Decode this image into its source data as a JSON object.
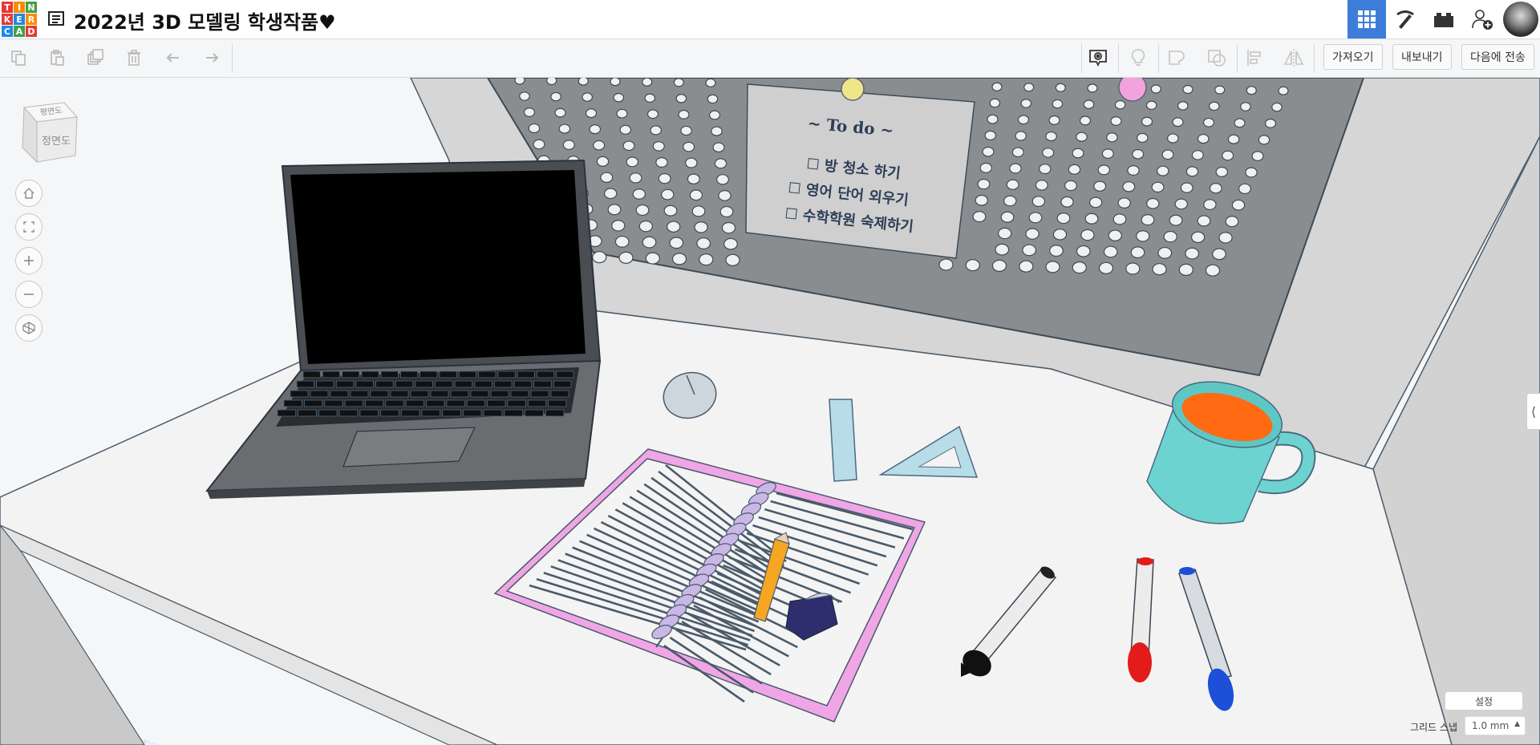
{
  "app": {
    "logo_letters": [
      "T",
      "I",
      "N",
      "K",
      "E",
      "R",
      "C",
      "A",
      "D"
    ],
    "logo_colors": [
      "#e53935",
      "#fb8c00",
      "#43a047",
      "#e53935",
      "#1e88e5",
      "#fb8c00",
      "#1e88e5",
      "#43a047",
      "#e53935"
    ],
    "title": "2022년 3D 모델링 학생작품♥",
    "accent": "#3c7dd9"
  },
  "top_icons": [
    "grid-view-icon",
    "pickaxe-icon",
    "bricks-icon",
    "add-user-icon",
    "avatar"
  ],
  "toolbar": {
    "left_icons": [
      "copy-icon",
      "paste-icon",
      "duplicate-icon",
      "delete-icon",
      "undo-icon",
      "redo-icon"
    ],
    "right_icons": [
      "notes-icon",
      "light-icon",
      "shape-icon",
      "group-icon",
      "align-icon",
      "mirror-icon"
    ],
    "import_label": "가져오기",
    "export_label": "내보내기",
    "send_label": "다음에 전송"
  },
  "viewcube": {
    "top_label": "평면도",
    "front_label": "정면도"
  },
  "nav_buttons": [
    "home-view-icon",
    "fit-all-icon",
    "zoom-in-icon",
    "zoom-out-icon",
    "perspective-icon"
  ],
  "scene": {
    "note_title": "~ To do ~",
    "note_items": [
      "방 청소 하기",
      "영어 단어 외우기",
      "수학학원 숙제하기"
    ],
    "colors": {
      "pegboard": "#8a8d90",
      "desk": "#f2f2f2",
      "notebook_cover": "#f0a6e6",
      "mug": "#6dd3d0",
      "coffee": "#ff6a13",
      "pencil": "#f5a623",
      "eraser": "#2e2e6e",
      "marker_black": "#111111",
      "marker_red": "#e31b1b",
      "marker_blue": "#1d4fd8"
    }
  },
  "bottom": {
    "settings_label": "설정",
    "snap_label": "그리드 스냅",
    "snap_value": "1.0 mm"
  }
}
